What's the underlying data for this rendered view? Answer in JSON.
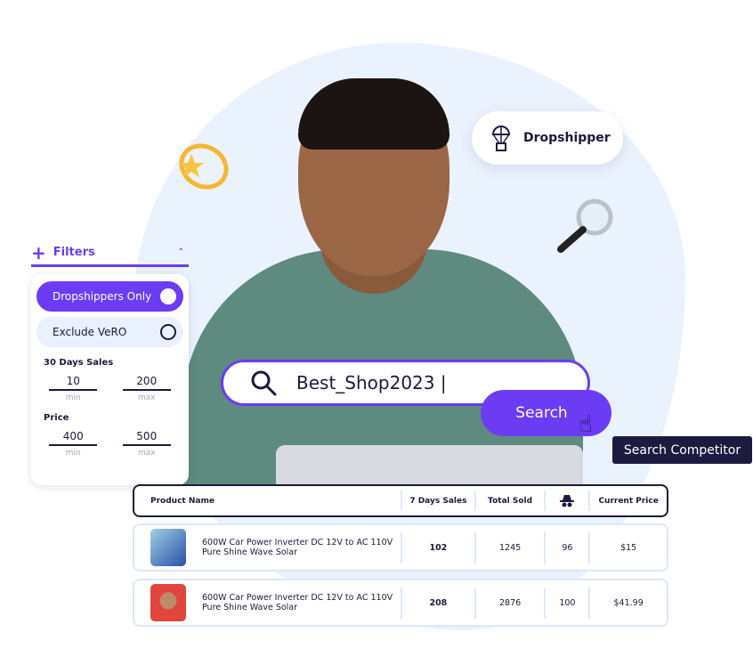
{
  "badge": {
    "label": "Dropshipper",
    "icon": "parachute-box-icon"
  },
  "filters": {
    "title": "Filters",
    "toggles": [
      {
        "label": "Dropshippers Only",
        "on": true
      },
      {
        "label": "Exclude VeRO",
        "on": false
      }
    ],
    "sales": {
      "label": "30 Days Sales",
      "min": "10",
      "max": "200",
      "min_label": "min",
      "max_label": "max"
    },
    "price": {
      "label": "Price",
      "min": "400",
      "max": "500",
      "min_label": "min",
      "max_label": "max"
    }
  },
  "search": {
    "value": "Best_Shop2023 |",
    "button": "Search",
    "tooltip": "Search Competitor"
  },
  "table": {
    "headers": [
      "Product Name",
      "7 Days Sales",
      "Total Sold",
      "",
      "Current Price"
    ],
    "spy_icon": "spy-icon",
    "rows": [
      {
        "name": "600W Car Power Inverter DC 12V to AC 110V Pure Shine Wave Solar",
        "sales7": "102",
        "total": "1245",
        "spy": "96",
        "price": "$15"
      },
      {
        "name": "600W Car Power Inverter DC 12V to AC 110V Pure Shine Wave Solar",
        "sales7": "208",
        "total": "2876",
        "spy": "100",
        "price": "$41.99"
      }
    ]
  },
  "colors": {
    "accent": "#6b3cf4",
    "dark": "#1c1b3f",
    "light": "#e8f1fd"
  }
}
